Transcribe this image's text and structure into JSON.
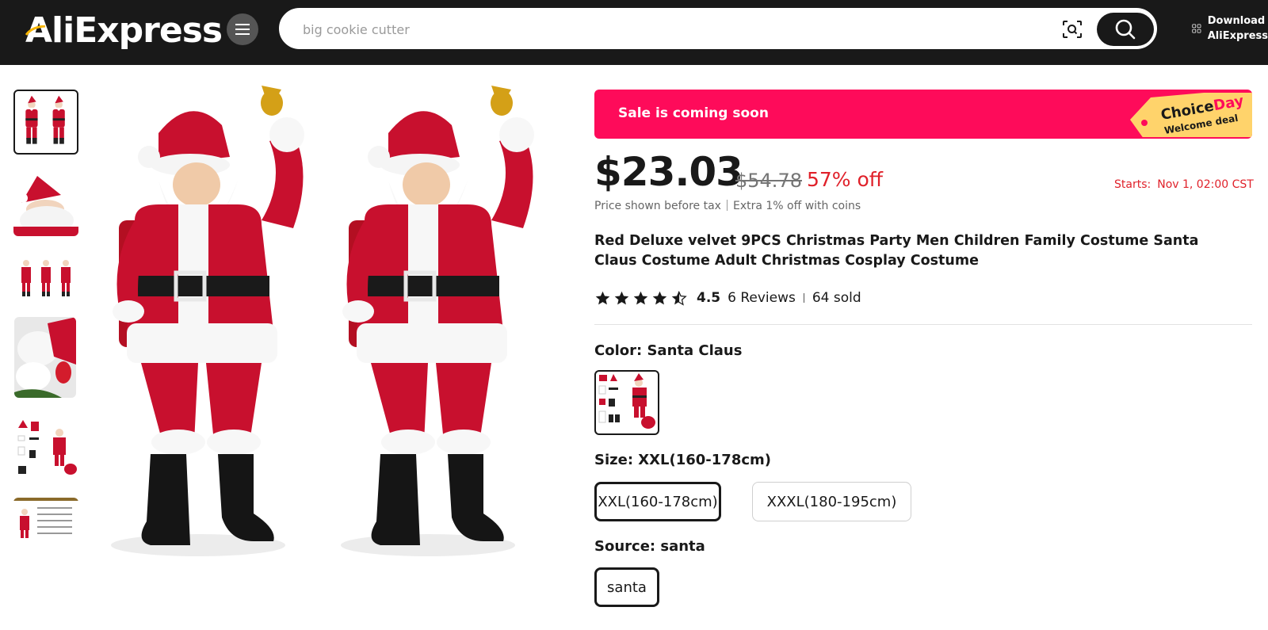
{
  "header": {
    "logo_text": "AliExpress",
    "search_placeholder": "big cookie cutter",
    "download_line1": "Download",
    "download_line2": "AliExpress",
    "icons": [
      "menu-icon",
      "camera-search-icon",
      "search-icon",
      "qr-code-icon"
    ]
  },
  "gallery": {
    "thumbnail_count": 6,
    "active_index": 0
  },
  "promo": {
    "sale_text": "Sale is coming soon",
    "tag_word1": "Choice",
    "tag_word2": "Day",
    "tag_sub": "Welcome deal",
    "accent_color": "#fe0b5a",
    "tag_color": "#ffd36b"
  },
  "pricing": {
    "price": "$23.03",
    "original_price": "$54.78",
    "discount": "57% off",
    "starts_label": "Starts:",
    "starts_value": "Nov 1, 02:00 CST",
    "tax_note": "Price shown before tax",
    "coins_note": "Extra 1% off with coins"
  },
  "product": {
    "title": "Red Deluxe velvet 9PCS Christmas Party Men Children Family Costume Santa Claus Costume Adult Christmas Cosplay Costume",
    "rating": "4.5",
    "rating_value": 4.5,
    "reviews": "6 Reviews",
    "sold": "64 sold"
  },
  "options": {
    "color_label": "Color: Santa Claus",
    "size_label": "Size: XXL(160-178cm)",
    "sizes": [
      "XXL(160-178cm)",
      "XXXL(180-195cm)"
    ],
    "selected_size": "XXL(160-178cm)",
    "source_label": "Source: santa",
    "source_option": "santa"
  }
}
